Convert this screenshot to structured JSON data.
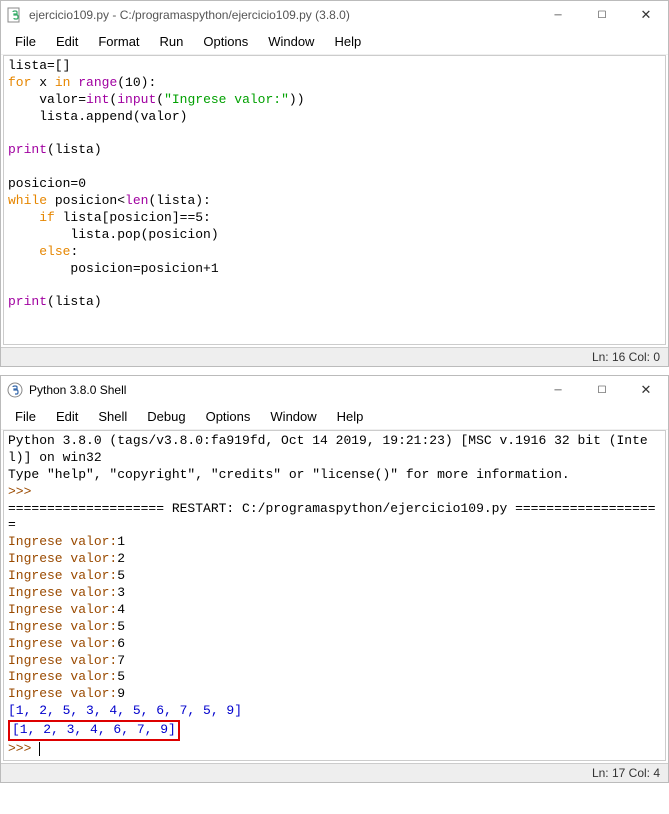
{
  "editor_window": {
    "title": "ejercicio109.py - C:/programaspython/ejercicio109.py (3.8.0)",
    "menus": [
      "File",
      "Edit",
      "Format",
      "Run",
      "Options",
      "Window",
      "Help"
    ],
    "code": {
      "l1a": "lista=[]",
      "l2_for": "for",
      "l2_mid": " x ",
      "l2_in": "in",
      "l2_sp": " ",
      "l2_range": "range",
      "l2_end": "(10):",
      "l3_pre": "    valor=",
      "l3_int": "int",
      "l3_po": "(",
      "l3_input": "input",
      "l3_po2": "(",
      "l3_str": "\"Ingrese valor:\"",
      "l3_pc": "))",
      "l4": "    lista.append(valor)",
      "l5": "",
      "l6_print": "print",
      "l6_end": "(lista)",
      "l7": "",
      "l8": "posicion=0",
      "l9_while": "while",
      "l9_mid": " posicion<",
      "l9_len": "len",
      "l9_end": "(lista):",
      "l10_pre": "    ",
      "l10_if": "if",
      "l10_end": " lista[posicion]==5:",
      "l11": "        lista.pop(posicion)",
      "l12_pre": "    ",
      "l12_else": "else",
      "l12_end": ":",
      "l13": "        posicion=posicion+1",
      "l14": "",
      "l15_print": "print",
      "l15_end": "(lista)"
    },
    "status": "Ln: 16  Col: 0"
  },
  "shell_window": {
    "title": "Python 3.8.0 Shell",
    "menus": [
      "File",
      "Edit",
      "Shell",
      "Debug",
      "Options",
      "Window",
      "Help"
    ],
    "banner1": "Python 3.8.0 (tags/v3.8.0:fa919fd, Oct 14 2019, 19:21:23) [MSC v.1916 32 bit (Intel)] on win32",
    "banner2": "Type \"help\", \"copyright\", \"credits\" or \"license()\" for more information.",
    "prompt": ">>>",
    "restart": "==================== RESTART: C:/programaspython/ejercicio109.py ===================",
    "inputs": [
      {
        "label": "Ingrese valor:",
        "val": "1"
      },
      {
        "label": "Ingrese valor:",
        "val": "2"
      },
      {
        "label": "Ingrese valor:",
        "val": "5"
      },
      {
        "label": "Ingrese valor:",
        "val": "3"
      },
      {
        "label": "Ingrese valor:",
        "val": "4"
      },
      {
        "label": "Ingrese valor:",
        "val": "5"
      },
      {
        "label": "Ingrese valor:",
        "val": "6"
      },
      {
        "label": "Ingrese valor:",
        "val": "7"
      },
      {
        "label": "Ingrese valor:",
        "val": "5"
      },
      {
        "label": "Ingrese valor:",
        "val": "9"
      }
    ],
    "list1": "[1, 2, 5, 3, 4, 5, 6, 7, 5, 9]",
    "list2": "[1, 2, 3, 4, 6, 7, 9]",
    "status": "Ln: 17  Col: 4"
  }
}
